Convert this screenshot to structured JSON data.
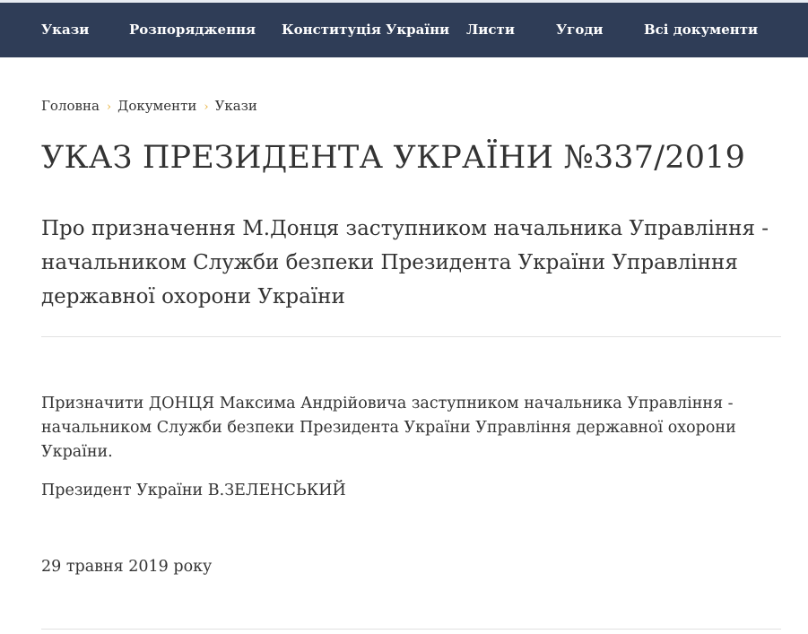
{
  "nav": {
    "items": [
      "Укази",
      "Розпорядження",
      "Конституція України",
      "Листи",
      "Угоди",
      "Всі документи"
    ]
  },
  "breadcrumb": {
    "items": [
      "Головна",
      "Документи",
      "Укази"
    ],
    "separator": "›"
  },
  "document": {
    "title": "УКАЗ ПРЕЗИДЕНТА УКРАЇНИ №337/2019",
    "subtitle": "Про призначення М.Донця заступником начальника Управління - начальником Служби безпеки Президента України Управління державної охорони України",
    "decree_text": "Призначити ДОНЦЯ Максима Андрійовича заступником начальника Управління - начальником Служби безпеки Президента України Управління державної охорони України.",
    "signature": "Президент України В.ЗЕЛЕНСЬКИЙ",
    "date": "29 травня 2019 року"
  },
  "colors": {
    "nav_background": "#2f3d57",
    "breadcrumb_separator": "#e9b543",
    "text": "#333333"
  }
}
